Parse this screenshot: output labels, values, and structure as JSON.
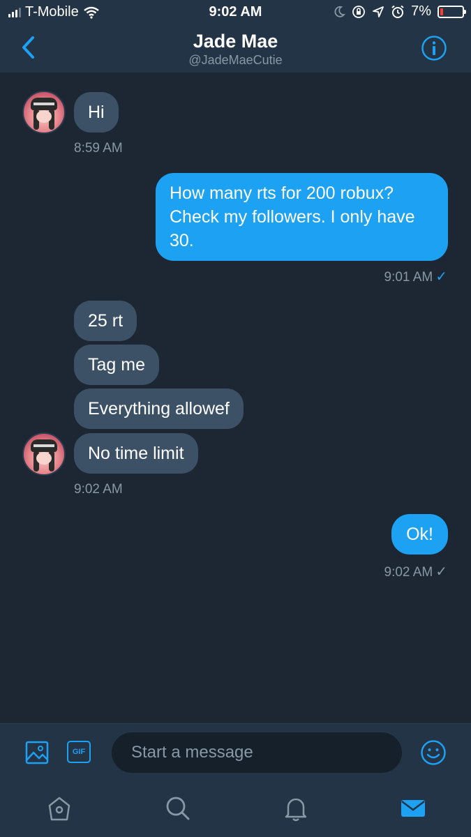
{
  "status_bar": {
    "carrier": "T-Mobile",
    "time": "9:02 AM",
    "battery": "7%"
  },
  "header": {
    "name": "Jade Mae",
    "handle": "@JadeMaeCutie"
  },
  "messages": [
    {
      "direction": "in",
      "text": "Hi",
      "time": "8:59 AM"
    },
    {
      "direction": "out",
      "text": "How many rts for 200 robux? Check my followers. I only have 30.",
      "time": "9:01 AM",
      "receipt": "✓"
    },
    {
      "direction": "in",
      "text": "25 rt"
    },
    {
      "direction": "in",
      "text": "Tag me"
    },
    {
      "direction": "in",
      "text": "Everything allowef"
    },
    {
      "direction": "in",
      "text": "No time limit",
      "time": "9:02 AM"
    },
    {
      "direction": "out",
      "text": "Ok!",
      "time": "9:02 AM",
      "receipt": "✓"
    }
  ],
  "composer": {
    "gif_label": "GIF",
    "placeholder": "Start a message"
  },
  "tabbar": [
    "home-icon",
    "search-icon",
    "notifications-icon",
    "messages-icon"
  ],
  "colors": {
    "background": "#1c2733",
    "header": "#243447",
    "incoming_bubble": "#3d5166",
    "outgoing_bubble": "#1da1f2",
    "accent": "#1da1f2",
    "muted": "#8899a6"
  }
}
